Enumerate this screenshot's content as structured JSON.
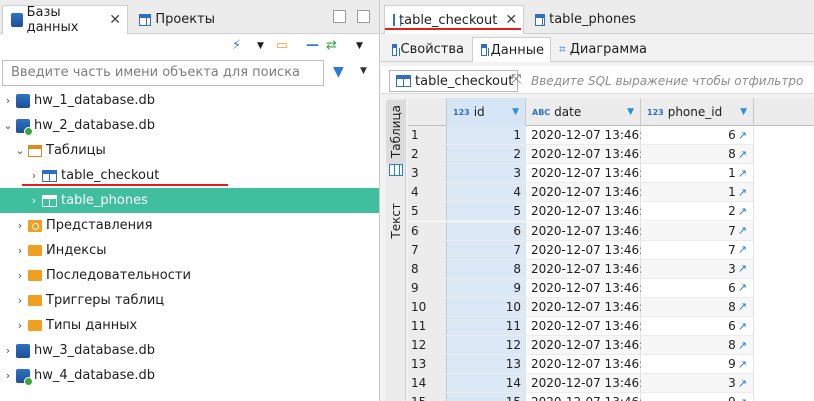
{
  "left_panel": {
    "tabs": [
      {
        "label": "Базы данных",
        "close": "✕"
      },
      {
        "label": "Проекты"
      }
    ],
    "search_placeholder": "Введите часть имени объекта для поиска",
    "tree": [
      {
        "label": "hw_1_database.db"
      },
      {
        "label": "hw_2_database.db"
      },
      {
        "label": "Таблицы"
      },
      {
        "label": "table_checkout"
      },
      {
        "label": "table_phones"
      },
      {
        "label": "Представления"
      },
      {
        "label": "Индексы"
      },
      {
        "label": "Последовательности"
      },
      {
        "label": "Триггеры таблиц"
      },
      {
        "label": "Типы данных"
      },
      {
        "label": "hw_3_database.db"
      },
      {
        "label": "hw_4_database.db"
      }
    ]
  },
  "right_panel": {
    "editor_tabs": [
      {
        "label": "table_checkout",
        "close": "✕"
      },
      {
        "label": "table_phones"
      }
    ],
    "sub_tabs": [
      {
        "label": "Свойства"
      },
      {
        "label": "Данные"
      },
      {
        "label": "Диаграмма"
      }
    ],
    "query_bar": {
      "table": "table_checkout",
      "placeholder": "Введите SQL выражение чтобы отфильтро"
    },
    "side_tabs": {
      "table": "Таблица",
      "text": "Текст"
    },
    "columns": [
      {
        "type": "123",
        "name": "id"
      },
      {
        "type": "ABC",
        "name": "date"
      },
      {
        "type": "123",
        "name": "phone_id"
      }
    ],
    "rows": [
      {
        "n": "1",
        "id": "1",
        "date": "2020-12-07 13:46:19",
        "phone_id": "6"
      },
      {
        "n": "2",
        "id": "2",
        "date": "2020-12-07 13:46:19",
        "phone_id": "8"
      },
      {
        "n": "3",
        "id": "3",
        "date": "2020-12-07 13:46:19",
        "phone_id": "1"
      },
      {
        "n": "4",
        "id": "4",
        "date": "2020-12-07 13:46:19",
        "phone_id": "1"
      },
      {
        "n": "5",
        "id": "5",
        "date": "2020-12-07 13:46:19",
        "phone_id": "2"
      },
      {
        "n": "6",
        "id": "6",
        "date": "2020-12-07 13:46:19",
        "phone_id": "7"
      },
      {
        "n": "7",
        "id": "7",
        "date": "2020-12-07 13:46:19",
        "phone_id": "7"
      },
      {
        "n": "8",
        "id": "8",
        "date": "2020-12-07 13:46:19",
        "phone_id": "3"
      },
      {
        "n": "9",
        "id": "9",
        "date": "2020-12-07 13:46:19",
        "phone_id": "6"
      },
      {
        "n": "10",
        "id": "10",
        "date": "2020-12-07 13:46:19",
        "phone_id": "8"
      },
      {
        "n": "11",
        "id": "11",
        "date": "2020-12-07 13:46:19",
        "phone_id": "6"
      },
      {
        "n": "12",
        "id": "12",
        "date": "2020-12-07 13:46:19",
        "phone_id": "8"
      },
      {
        "n": "13",
        "id": "13",
        "date": "2020-12-07 13:46:19",
        "phone_id": "9"
      },
      {
        "n": "14",
        "id": "14",
        "date": "2020-12-07 13:46:19",
        "phone_id": "3"
      },
      {
        "n": "15",
        "id": "15",
        "date": "2020-12-07 13:46:19",
        "phone_id": "9"
      }
    ]
  },
  "colors": {
    "selection": "#3fbf9e",
    "annotation": "#e0201f",
    "accent": "#2a7bd6"
  }
}
